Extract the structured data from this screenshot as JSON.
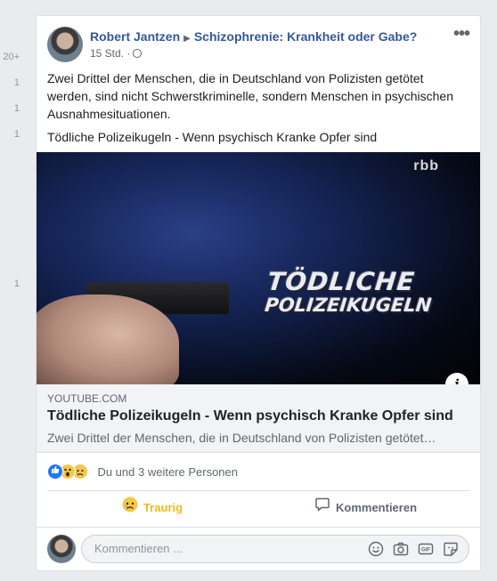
{
  "gutter": {
    "counts": [
      "20+",
      "1",
      "1",
      "1",
      "1"
    ]
  },
  "post": {
    "author": "Robert Jantzen",
    "group": "Schizophrenie: Krankheit oder Gabe?",
    "time": "15 Std. ·",
    "body_1": "Zwei Drittel der Menschen, die in Deutschland von Polizisten getötet werden, sind nicht Schwerstkriminelle, sondern Menschen in psychischen Ausnahmesituationen.",
    "body_2": "Tödliche Polizeikugeln - Wenn psychisch Kranke Opfer sind"
  },
  "video": {
    "watermark": "rbb",
    "title_line_1": "TÖDLICHE",
    "title_line_2": "POLIZEIKUGELN",
    "info_label": "i"
  },
  "link": {
    "domain": "YOUTUBE.COM",
    "title": "Tödliche Polizeikugeln - Wenn psychisch Kranke Opfer sind",
    "description": "Zwei Drittel der Menschen, die in Deutschland von Polizisten getötet…"
  },
  "reactions": {
    "summary": "Du und 3 weitere Personen"
  },
  "actions": {
    "sad_label": "Traurig",
    "comment_label": "Kommentieren"
  },
  "comment": {
    "placeholder": "Kommentieren ..."
  },
  "colors": {
    "link_blue": "#365899",
    "sad_yellow": "#f0ba15",
    "like_blue": "#2078f4",
    "background": "#e9ebee"
  },
  "icons": [
    "ellipsis-icon",
    "globe-icon",
    "info-icon",
    "like-reaction-icon",
    "wow-reaction-icon",
    "sad-reaction-icon",
    "comment-icon",
    "emoji-icon",
    "camera-icon",
    "gif-icon",
    "sticker-icon"
  ]
}
